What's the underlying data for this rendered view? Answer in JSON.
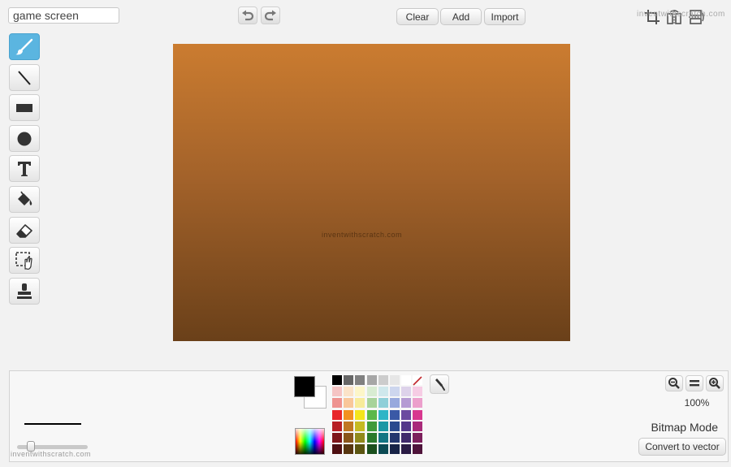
{
  "costume": {
    "name": "game screen"
  },
  "toolbar": {
    "clear_label": "Clear",
    "add_label": "Add",
    "import_label": "Import"
  },
  "watermark": "inventwithscratch.com",
  "canvas": {
    "gradient_top": "#cb7c30",
    "gradient_bottom": "#6a4019",
    "watermark": "inventwithscratch.com"
  },
  "colors": {
    "primary": "#000000",
    "secondary": "#ffffff",
    "palette": [
      [
        "#000000",
        "#666666",
        "#808080",
        "#a6a6a6",
        "#cccccc",
        "#e6e6e6",
        "#ffffff",
        "transparent"
      ],
      [
        "#f5c4c4",
        "#fbe3c8",
        "#fdf6c8",
        "#d8ecd2",
        "#cfe8ec",
        "#cdd6ee",
        "#ddd2ea",
        "#f6cce4"
      ],
      [
        "#ee9390",
        "#f9c79a",
        "#f8eb9a",
        "#a8d39a",
        "#8fcfd8",
        "#98a9dd",
        "#b59bd3",
        "#ec9fcc"
      ],
      [
        "#e8262a",
        "#f2911f",
        "#f4e51c",
        "#5bb84a",
        "#2fb5c6",
        "#3a59a6",
        "#6b4aa0",
        "#d8378f"
      ],
      [
        "#b72025",
        "#c07722",
        "#c6ba23",
        "#3f9a3c",
        "#1b97a4",
        "#2b4a8e",
        "#54388a",
        "#a92a7a"
      ],
      [
        "#7e1619",
        "#8a561a",
        "#918a1b",
        "#2a7a2c",
        "#137583",
        "#23366e",
        "#40296b",
        "#7c1f5c"
      ],
      [
        "#4e0f11",
        "#573610",
        "#5b5511",
        "#1a4f1d",
        "#0c4b54",
        "#172347",
        "#2a1b45",
        "#4f143b"
      ]
    ]
  },
  "zoom": {
    "level": "100%"
  },
  "mode": {
    "label": "Bitmap Mode",
    "convert_label": "Convert to vector"
  },
  "brush": {
    "size_fraction": 0.15
  }
}
